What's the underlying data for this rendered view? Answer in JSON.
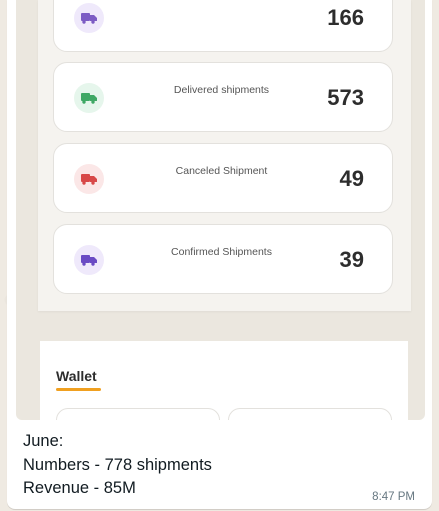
{
  "screenshot": {
    "stats": [
      {
        "label": "",
        "value": "166",
        "icon": "truck-icon",
        "color": "#7c5cc4",
        "bg": "#efe9fb"
      },
      {
        "label": "Delivered shipments",
        "value": "573",
        "icon": "truck-icon",
        "color": "#3fa865",
        "bg": "#e6f6ec"
      },
      {
        "label": "Canceled Shipment",
        "value": "49",
        "icon": "truck-icon",
        "color": "#d84848",
        "bg": "#fbe7e7"
      },
      {
        "label": "Confirmed Shipments",
        "value": "39",
        "icon": "truck-icon",
        "color": "#6a4bc4",
        "bg": "#efe9fb"
      }
    ],
    "wallet": {
      "title": "Wallet",
      "accent": "#f0a020"
    }
  },
  "message": {
    "lines": [
      "June:",
      "Numbers - 778 shipments",
      "Revenue - 85M"
    ],
    "time": "8:47 PM"
  }
}
